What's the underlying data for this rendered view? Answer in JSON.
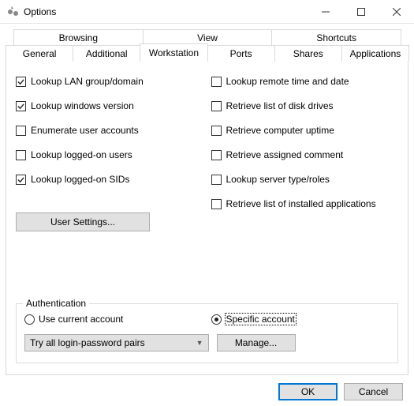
{
  "window": {
    "title": "Options"
  },
  "tabs": {
    "upper": [
      "Browsing",
      "View",
      "Shortcuts"
    ],
    "lower": [
      "General",
      "Additional",
      "Workstation",
      "Ports",
      "Shares",
      "Applications"
    ]
  },
  "checks_left": [
    {
      "label": "Lookup LAN group/domain",
      "checked": true
    },
    {
      "label": "Lookup windows version",
      "checked": true
    },
    {
      "label": "Enumerate user accounts",
      "checked": false
    },
    {
      "label": "Lookup logged-on users",
      "checked": false
    },
    {
      "label": "Lookup logged-on SIDs",
      "checked": true
    }
  ],
  "checks_right": [
    {
      "label": "Lookup remote time and date",
      "checked": false
    },
    {
      "label": "Retrieve list of disk drives",
      "checked": false
    },
    {
      "label": "Retrieve computer uptime",
      "checked": false
    },
    {
      "label": "Retrieve assigned comment",
      "checked": false
    },
    {
      "label": "Lookup server type/roles",
      "checked": false
    },
    {
      "label": "Retrieve list of installed applications",
      "checked": false
    }
  ],
  "buttons": {
    "user_settings": "User Settings...",
    "manage": "Manage...",
    "ok": "OK",
    "cancel": "Cancel"
  },
  "auth": {
    "legend": "Authentication",
    "use_current": "Use current account",
    "specific": "Specific account",
    "combo": "Try all login-password pairs"
  }
}
